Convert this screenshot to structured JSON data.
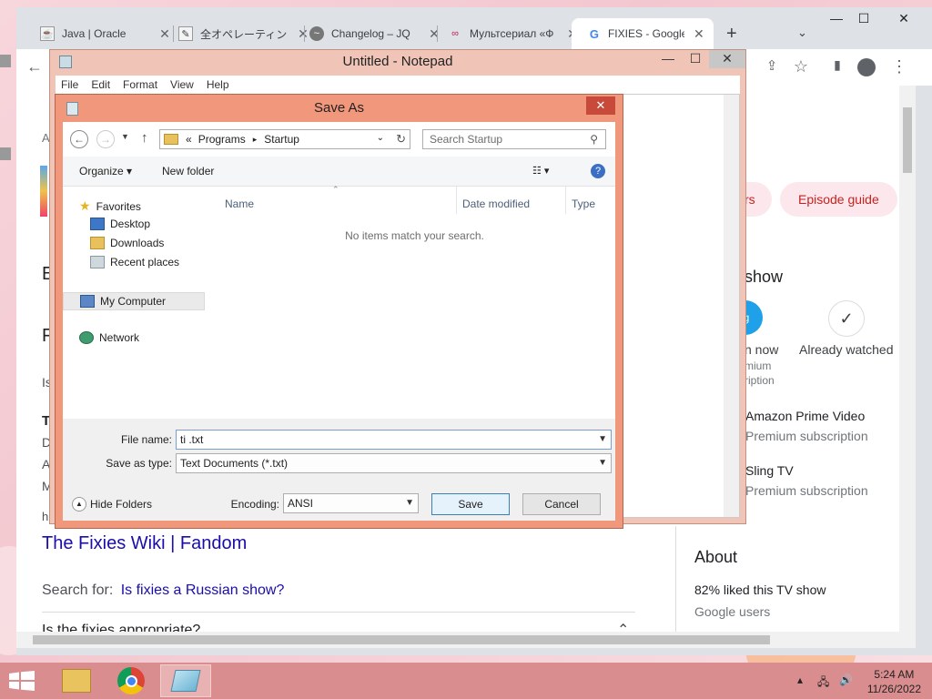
{
  "browser": {
    "tabs": [
      {
        "label": "Java | Oracle",
        "icon": "java-icon"
      },
      {
        "label": "全オペレーティング",
        "icon": "doc-icon"
      },
      {
        "label": "Changelog – JQ",
        "icon": "changelog-icon"
      },
      {
        "label": "Мультсериал «Ф",
        "icon": "multi-icon"
      },
      {
        "label": "FIXIES - Google",
        "icon": "google-icon"
      }
    ],
    "new_tab": "+",
    "tab_search": "⌄",
    "win_min": "—",
    "win_max": "☐",
    "win_close": "✕",
    "back": "←",
    "page": {
      "pills": [
        "Episode guide",
        "rs"
      ],
      "section_show": "show",
      "watch_now": "n now",
      "premium_1": "mium",
      "premium_2": "ription",
      "already_watched": "Already watched",
      "check": "✓",
      "amazon": "Amazon Prime Video",
      "amazon_sub": "Premium subscription",
      "sling": "Sling TV",
      "sling_sub": "Premium subscription",
      "about": "About",
      "liked": "82% liked this TV show",
      "users": "Google users",
      "result_link": "The Fixies Wiki | Fandom",
      "search_for": "Search for:",
      "search_for_link": "Is fixies a Russian show?",
      "faq": "Is the fixies appropriate?",
      "left_chars": [
        "E",
        "F",
        "Is",
        "T",
        "D",
        "A",
        "M",
        "h"
      ],
      "left_misc": [
        "A"
      ]
    }
  },
  "notepad": {
    "title": "Untitled - Notepad",
    "menu": [
      "File",
      "Edit",
      "Format",
      "View",
      "Help"
    ]
  },
  "dialog": {
    "title": "Save As",
    "breadcrumb": [
      "«",
      "Programs",
      "▸",
      "Startup"
    ],
    "search_placeholder": "Search Startup",
    "organize": "Organize ▾",
    "new_folder": "New folder",
    "help": "?",
    "nav": {
      "favorites": "Favorites",
      "desktop": "Desktop",
      "downloads": "Downloads",
      "recent": "Recent places",
      "computer": "My Computer",
      "network": "Network"
    },
    "columns": [
      "Name",
      "Date modified",
      "Type"
    ],
    "empty": "No items match your search.",
    "file_name_label": "File name:",
    "file_name_value": "ti .txt",
    "save_type_label": "Save as type:",
    "save_type_value": "Text Documents (*.txt)",
    "hide_folders": "Hide Folders",
    "encoding_label": "Encoding:",
    "encoding_value": "ANSI",
    "save": "Save",
    "cancel": "Cancel"
  },
  "taskbar": {
    "time": "5:24 AM",
    "date": "11/26/2022",
    "tray": "▴"
  },
  "colors": {
    "dialog_frame": "#f0977c",
    "taskbar": "#d98d8f",
    "link": "#1a0dab"
  }
}
